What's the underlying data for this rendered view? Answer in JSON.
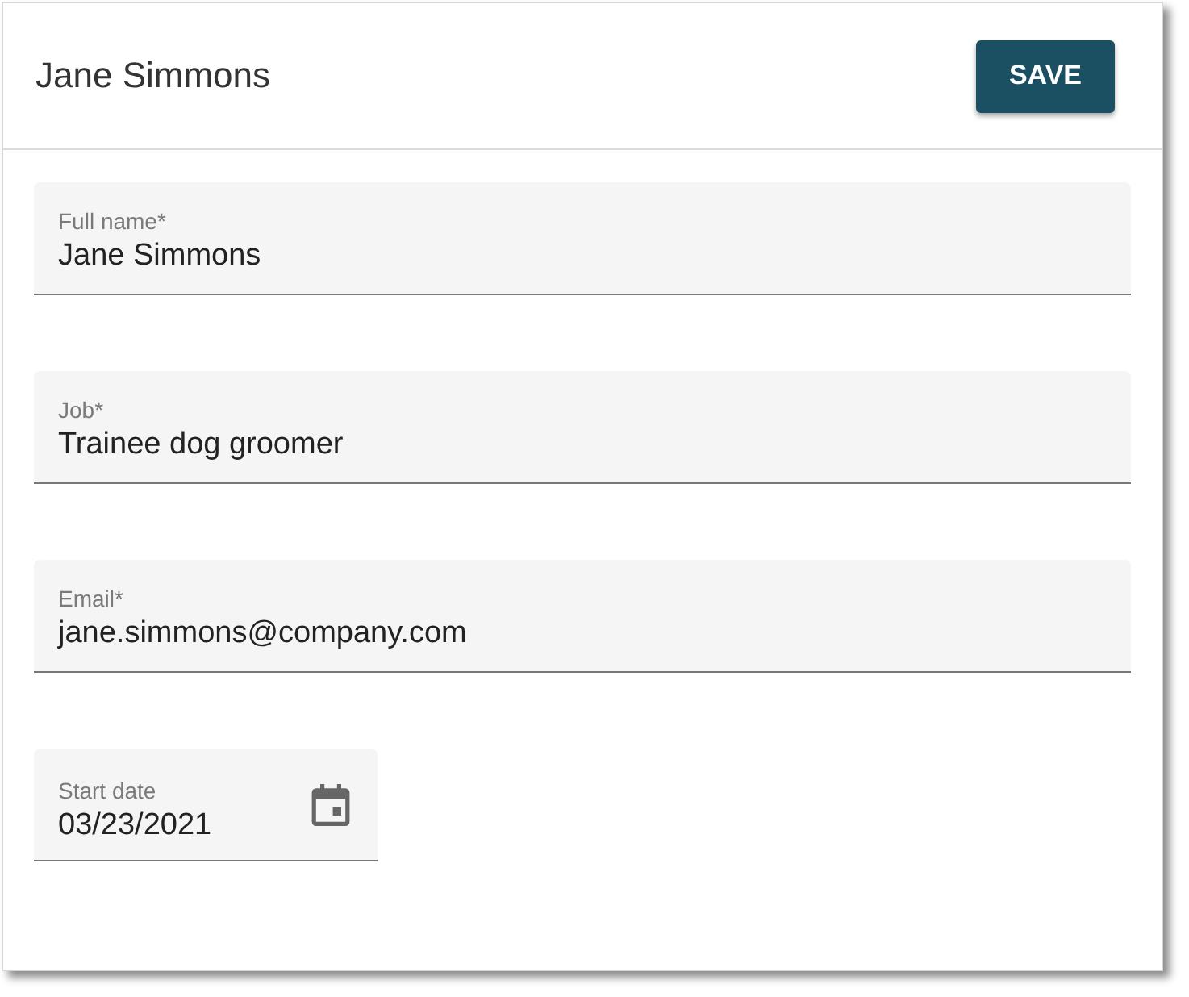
{
  "header": {
    "title": "Jane Simmons",
    "save_button": "SAVE"
  },
  "fields": [
    {
      "kind": "text",
      "label": "Full name*",
      "value": "Jane Simmons"
    },
    {
      "kind": "text",
      "label": "Job*",
      "value": "Trainee dog groomer"
    },
    {
      "kind": "text",
      "label": "Email*",
      "value": "jane.simmons@company.com"
    },
    {
      "kind": "date",
      "label": "Start date",
      "value": "03/23/2021"
    }
  ]
}
